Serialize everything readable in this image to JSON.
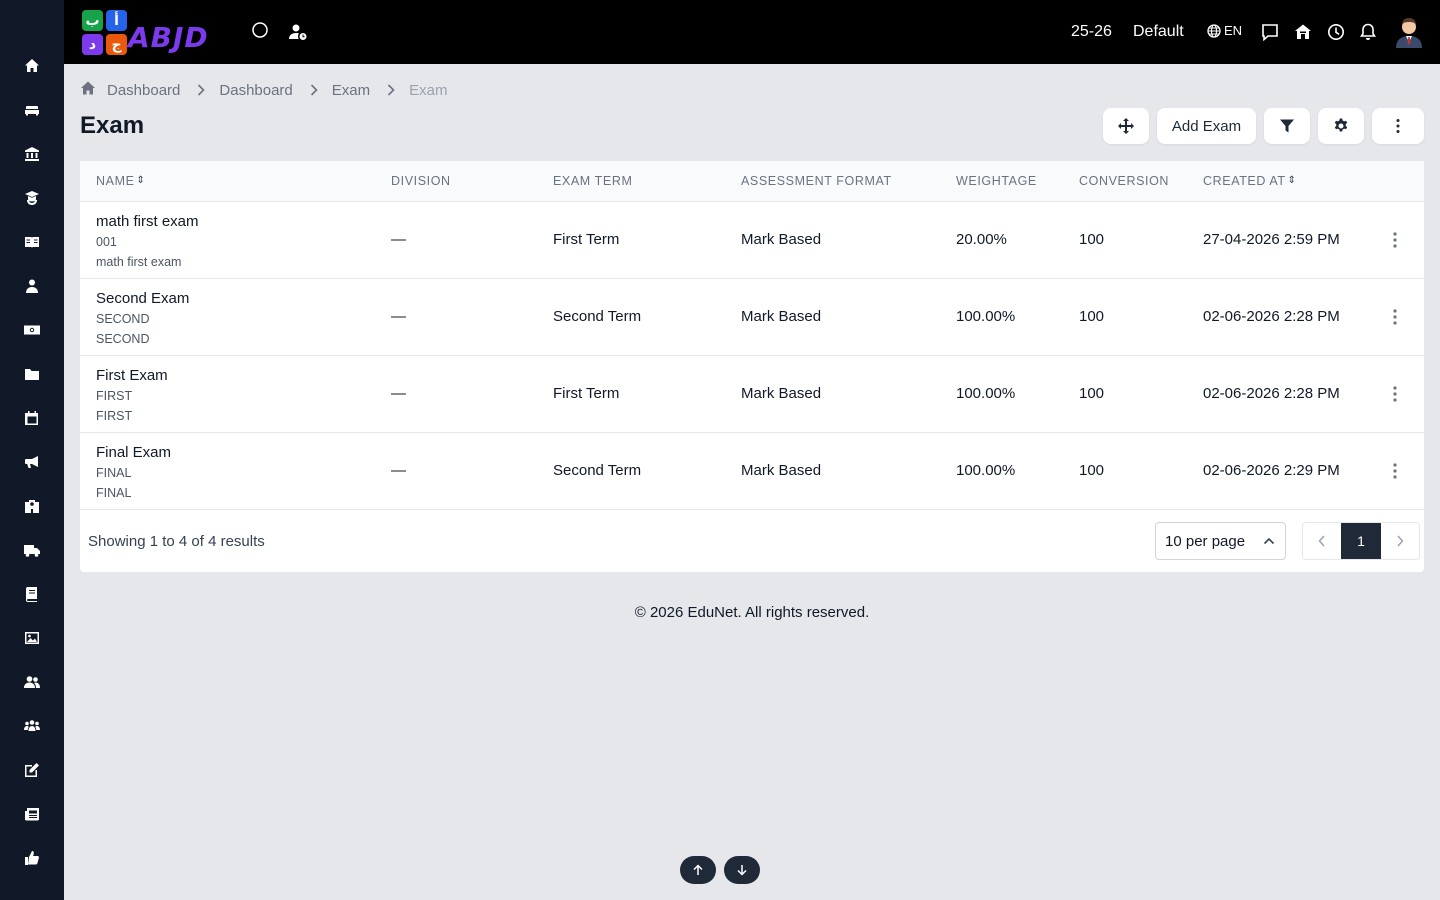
{
  "app": {
    "logo_text": "ABJD",
    "logo_tiles": [
      "ب",
      "أ",
      "د",
      "ج"
    ],
    "brand_color": "#7c3aed"
  },
  "sidebar": {
    "items": [
      {
        "name": "home-icon"
      },
      {
        "name": "sofa-icon"
      },
      {
        "name": "bank-icon"
      },
      {
        "name": "graduate-icon"
      },
      {
        "name": "book-open-icon"
      },
      {
        "name": "user-icon"
      },
      {
        "name": "money-icon"
      },
      {
        "name": "folder-icon"
      },
      {
        "name": "calendar-icon"
      },
      {
        "name": "megaphone-icon"
      },
      {
        "name": "school-icon"
      },
      {
        "name": "truck-icon"
      },
      {
        "name": "book-icon"
      },
      {
        "name": "image-icon"
      },
      {
        "name": "users-icon"
      },
      {
        "name": "people-group-icon"
      },
      {
        "name": "edit-icon"
      },
      {
        "name": "newspaper-icon"
      },
      {
        "name": "thumbs-up-icon"
      }
    ]
  },
  "topbar": {
    "session": "25-26",
    "branch": "Default",
    "language": "EN"
  },
  "breadcrumb": {
    "items": [
      "Dashboard",
      "Dashboard",
      "Exam",
      "Exam"
    ]
  },
  "page": {
    "title": "Exam",
    "add_button": "Add Exam"
  },
  "table": {
    "columns": [
      "NAME",
      "DIVISION",
      "EXAM TERM",
      "ASSESSMENT FORMAT",
      "WEIGHTAGE",
      "CONVERSION",
      "CREATED AT"
    ],
    "rows": [
      {
        "name": "math first exam",
        "code": "001",
        "description": "math first exam",
        "division": "—",
        "exam_term": "First Term",
        "format": "Mark Based",
        "weightage": "20.00%",
        "conversion": "100",
        "created_at": "27-04-2026 2:59 PM"
      },
      {
        "name": "Second Exam",
        "code": "SECOND",
        "description": "SECOND",
        "division": "—",
        "exam_term": "Second Term",
        "format": "Mark Based",
        "weightage": "100.00%",
        "conversion": "100",
        "created_at": "02-06-2026 2:28 PM"
      },
      {
        "name": "First Exam",
        "code": "FIRST",
        "description": "FIRST",
        "division": "—",
        "exam_term": "First Term",
        "format": "Mark Based",
        "weightage": "100.00%",
        "conversion": "100",
        "created_at": "02-06-2026 2:28 PM"
      },
      {
        "name": "Final Exam",
        "code": "FINAL",
        "description": "FINAL",
        "division": "—",
        "exam_term": "Second Term",
        "format": "Mark Based",
        "weightage": "100.00%",
        "conversion": "100",
        "created_at": "02-06-2026 2:29 PM"
      }
    ]
  },
  "pagination": {
    "summary": "Showing 1 to 4 of 4 results",
    "per_page": "10 per page",
    "current_page": "1"
  },
  "footer": {
    "text": "© 2026 EduNet. All rights reserved."
  }
}
